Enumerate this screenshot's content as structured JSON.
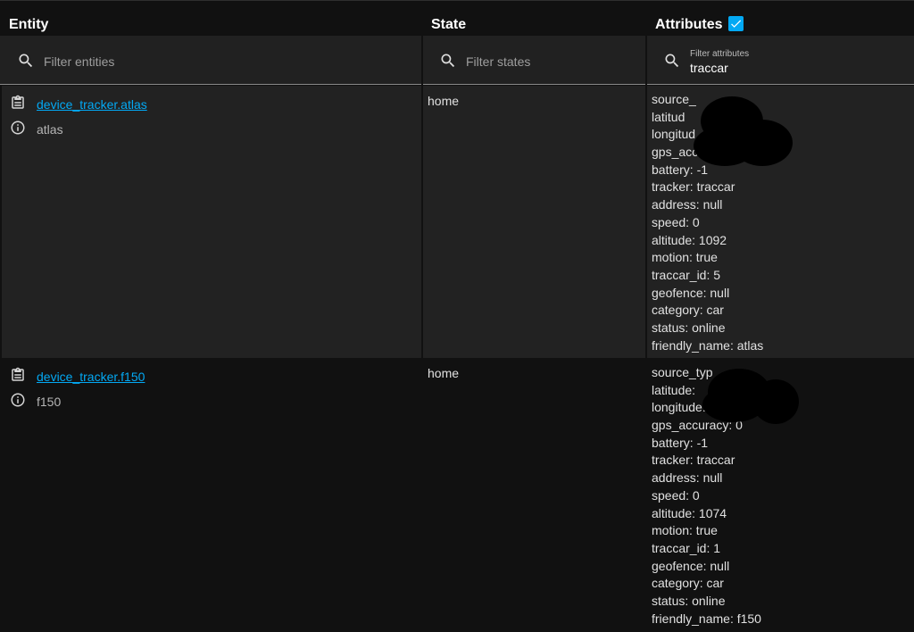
{
  "headers": {
    "entity": "Entity",
    "state": "State",
    "attributes": "Attributes"
  },
  "filters": {
    "entities_placeholder": "Filter entities",
    "states_placeholder": "Filter states",
    "attributes_label": "Filter attributes",
    "attributes_value": "traccar"
  },
  "attributes_checkbox_checked": true,
  "rows": [
    {
      "entity_id": "device_tracker.atlas",
      "friendly_name": "atlas",
      "state": "home",
      "attributes": [
        "source_",
        "latitud",
        "longitud",
        "gps_accu",
        "battery: -1",
        "tracker: traccar",
        "address: null",
        "speed: 0",
        "altitude: 1092",
        "motion: true",
        "traccar_id: 5",
        "geofence: null",
        "category: car",
        "status: online",
        "friendly_name: atlas"
      ]
    },
    {
      "entity_id": "device_tracker.f150",
      "friendly_name": "f150",
      "state": "home",
      "attributes": [
        "source_typ",
        "latitude:",
        "longitude:",
        "gps_accuracy: 0",
        "battery: -1",
        "tracker: traccar",
        "address: null",
        "speed: 0",
        "altitude: 1074",
        "motion: true",
        "traccar_id: 1",
        "geofence: null",
        "category: car",
        "status: online",
        "friendly_name: f150"
      ]
    }
  ],
  "colors": {
    "accent": "#03a9f4",
    "background": "#111111",
    "row_alt": "#222222"
  }
}
